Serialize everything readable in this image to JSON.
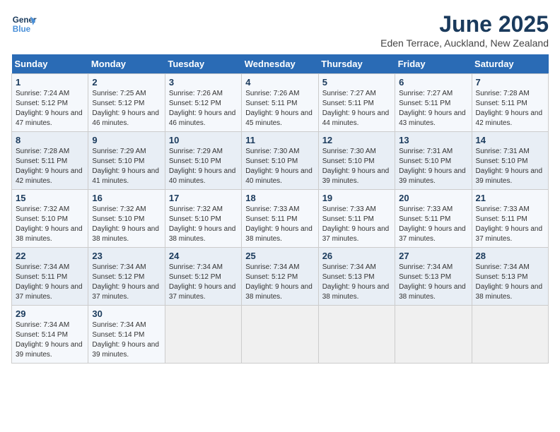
{
  "logo": {
    "line1": "General",
    "line2": "Blue"
  },
  "title": "June 2025",
  "location": "Eden Terrace, Auckland, New Zealand",
  "weekdays": [
    "Sunday",
    "Monday",
    "Tuesday",
    "Wednesday",
    "Thursday",
    "Friday",
    "Saturday"
  ],
  "weeks": [
    [
      {
        "day": "1",
        "sunrise": "7:24 AM",
        "sunset": "5:12 PM",
        "daylight": "9 hours and 47 minutes."
      },
      {
        "day": "2",
        "sunrise": "7:25 AM",
        "sunset": "5:12 PM",
        "daylight": "9 hours and 46 minutes."
      },
      {
        "day": "3",
        "sunrise": "7:26 AM",
        "sunset": "5:12 PM",
        "daylight": "9 hours and 46 minutes."
      },
      {
        "day": "4",
        "sunrise": "7:26 AM",
        "sunset": "5:11 PM",
        "daylight": "9 hours and 45 minutes."
      },
      {
        "day": "5",
        "sunrise": "7:27 AM",
        "sunset": "5:11 PM",
        "daylight": "9 hours and 44 minutes."
      },
      {
        "day": "6",
        "sunrise": "7:27 AM",
        "sunset": "5:11 PM",
        "daylight": "9 hours and 43 minutes."
      },
      {
        "day": "7",
        "sunrise": "7:28 AM",
        "sunset": "5:11 PM",
        "daylight": "9 hours and 42 minutes."
      }
    ],
    [
      {
        "day": "8",
        "sunrise": "7:28 AM",
        "sunset": "5:11 PM",
        "daylight": "9 hours and 42 minutes."
      },
      {
        "day": "9",
        "sunrise": "7:29 AM",
        "sunset": "5:10 PM",
        "daylight": "9 hours and 41 minutes."
      },
      {
        "day": "10",
        "sunrise": "7:29 AM",
        "sunset": "5:10 PM",
        "daylight": "9 hours and 40 minutes."
      },
      {
        "day": "11",
        "sunrise": "7:30 AM",
        "sunset": "5:10 PM",
        "daylight": "9 hours and 40 minutes."
      },
      {
        "day": "12",
        "sunrise": "7:30 AM",
        "sunset": "5:10 PM",
        "daylight": "9 hours and 39 minutes."
      },
      {
        "day": "13",
        "sunrise": "7:31 AM",
        "sunset": "5:10 PM",
        "daylight": "9 hours and 39 minutes."
      },
      {
        "day": "14",
        "sunrise": "7:31 AM",
        "sunset": "5:10 PM",
        "daylight": "9 hours and 39 minutes."
      }
    ],
    [
      {
        "day": "15",
        "sunrise": "7:32 AM",
        "sunset": "5:10 PM",
        "daylight": "9 hours and 38 minutes."
      },
      {
        "day": "16",
        "sunrise": "7:32 AM",
        "sunset": "5:10 PM",
        "daylight": "9 hours and 38 minutes."
      },
      {
        "day": "17",
        "sunrise": "7:32 AM",
        "sunset": "5:10 PM",
        "daylight": "9 hours and 38 minutes."
      },
      {
        "day": "18",
        "sunrise": "7:33 AM",
        "sunset": "5:11 PM",
        "daylight": "9 hours and 38 minutes."
      },
      {
        "day": "19",
        "sunrise": "7:33 AM",
        "sunset": "5:11 PM",
        "daylight": "9 hours and 37 minutes."
      },
      {
        "day": "20",
        "sunrise": "7:33 AM",
        "sunset": "5:11 PM",
        "daylight": "9 hours and 37 minutes."
      },
      {
        "day": "21",
        "sunrise": "7:33 AM",
        "sunset": "5:11 PM",
        "daylight": "9 hours and 37 minutes."
      }
    ],
    [
      {
        "day": "22",
        "sunrise": "7:34 AM",
        "sunset": "5:11 PM",
        "daylight": "9 hours and 37 minutes."
      },
      {
        "day": "23",
        "sunrise": "7:34 AM",
        "sunset": "5:12 PM",
        "daylight": "9 hours and 37 minutes."
      },
      {
        "day": "24",
        "sunrise": "7:34 AM",
        "sunset": "5:12 PM",
        "daylight": "9 hours and 37 minutes."
      },
      {
        "day": "25",
        "sunrise": "7:34 AM",
        "sunset": "5:12 PM",
        "daylight": "9 hours and 38 minutes."
      },
      {
        "day": "26",
        "sunrise": "7:34 AM",
        "sunset": "5:13 PM",
        "daylight": "9 hours and 38 minutes."
      },
      {
        "day": "27",
        "sunrise": "7:34 AM",
        "sunset": "5:13 PM",
        "daylight": "9 hours and 38 minutes."
      },
      {
        "day": "28",
        "sunrise": "7:34 AM",
        "sunset": "5:13 PM",
        "daylight": "9 hours and 38 minutes."
      }
    ],
    [
      {
        "day": "29",
        "sunrise": "7:34 AM",
        "sunset": "5:14 PM",
        "daylight": "9 hours and 39 minutes."
      },
      {
        "day": "30",
        "sunrise": "7:34 AM",
        "sunset": "5:14 PM",
        "daylight": "9 hours and 39 minutes."
      },
      {
        "day": "",
        "sunrise": "",
        "sunset": "",
        "daylight": ""
      },
      {
        "day": "",
        "sunrise": "",
        "sunset": "",
        "daylight": ""
      },
      {
        "day": "",
        "sunrise": "",
        "sunset": "",
        "daylight": ""
      },
      {
        "day": "",
        "sunrise": "",
        "sunset": "",
        "daylight": ""
      },
      {
        "day": "",
        "sunrise": "",
        "sunset": "",
        "daylight": ""
      }
    ]
  ]
}
